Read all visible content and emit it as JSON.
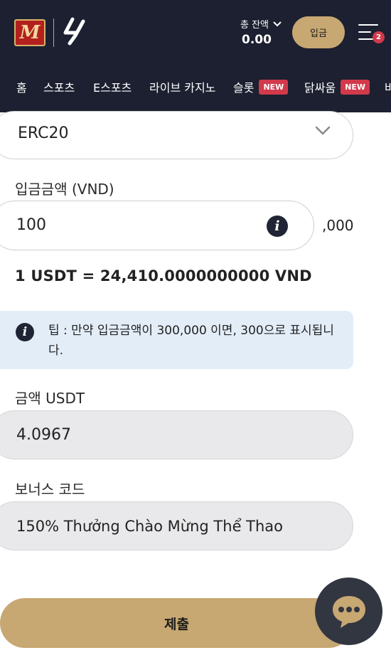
{
  "header": {
    "balance_label": "총 잔액",
    "balance_value": "0.00",
    "deposit_label": "입금",
    "menu_badge": "2"
  },
  "nav": {
    "items": [
      {
        "label": "홈"
      },
      {
        "label": "스포츠"
      },
      {
        "label": "E스포츠"
      },
      {
        "label": "라이브 카지노"
      },
      {
        "label": "슬롯",
        "badge": "NEW"
      },
      {
        "label": "닭싸움",
        "badge": "NEW"
      },
      {
        "label": "바"
      }
    ]
  },
  "form": {
    "network_value": "ERC20",
    "amount_label": "입금금액 (VND)",
    "amount_value": "100",
    "amount_suffix": ",000",
    "rate_text": "1 USDT = 24,410.0000000000 VND",
    "tip_text": "팁 : 만약 입금금액이 300,000 이면, 300으로 표시됩니다.",
    "usdt_label": "금액 USDT",
    "usdt_value": "4.0967",
    "bonus_label": "보너스 코드",
    "bonus_value": "150% Thưởng Chào Mừng Thể Thao",
    "submit_label": "제출"
  },
  "colors": {
    "header_bg": "#1c2030",
    "accent_gold": "#c7a772",
    "badge_red": "#d23a4c",
    "tip_bg": "#e3edf8"
  },
  "icons": [
    "logo-m-icon",
    "laliga-logo-icon",
    "chevron-down-icon",
    "menu-icon",
    "info-icon",
    "chat-icon"
  ]
}
